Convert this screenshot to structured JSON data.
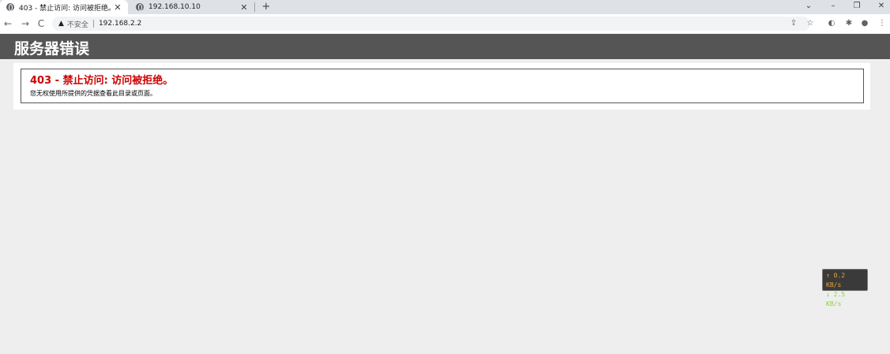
{
  "browser": {
    "tabs": [
      {
        "title": "403 - 禁止访问: 访问被拒绝。",
        "close": "✕"
      },
      {
        "title": "192.168.10.10",
        "close": "✕"
      }
    ],
    "new_tab": "+",
    "window_controls": {
      "dropdown": "⌄",
      "minimize": "–",
      "restore": "❐",
      "close": "✕"
    },
    "nav": {
      "back": "←",
      "forward": "→",
      "reload": "C"
    },
    "address_bar": {
      "warning_icon": "▲",
      "security_label": "不安全",
      "url": "192.168.2.2"
    },
    "toolbar_icons": [
      "share-icon",
      "star-icon",
      "extension-icon",
      "puzzle-icon",
      "profile-icon",
      "menu-icon"
    ]
  },
  "page": {
    "header_title": "服务器错误",
    "error_title": "403 - 禁止访问: 访问被拒绝。",
    "error_description": "您无权使用所提供的凭据查看此目录或页面。"
  },
  "net_speed": {
    "up": "↑ 0.2 KB/s",
    "down": "↓ 2.5 KB/s"
  }
}
